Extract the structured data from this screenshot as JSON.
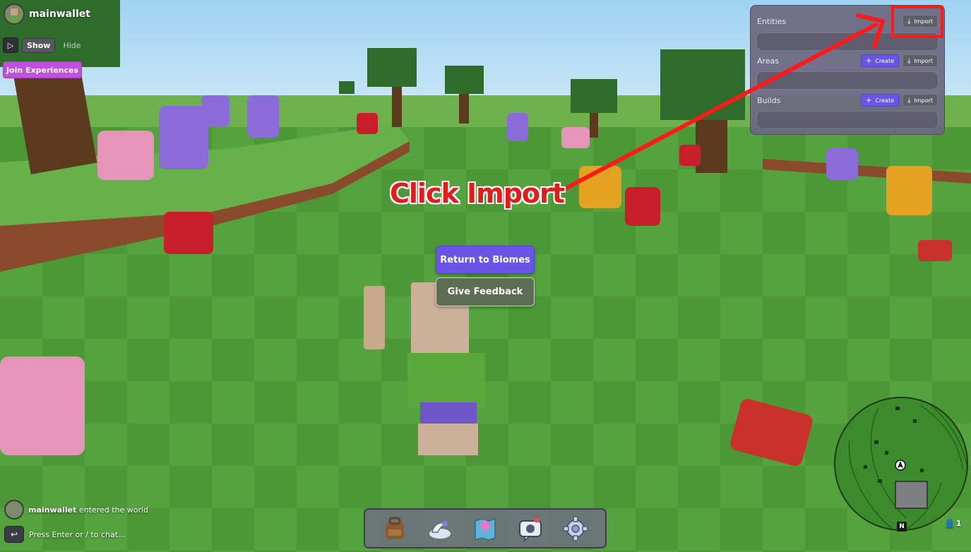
{
  "hud": {
    "username": "mainwallet",
    "show_label": "Show",
    "hide_label": "Hide",
    "join_label": "Join Experiences"
  },
  "center": {
    "return_label": "Return to Biomes",
    "feedback_label": "Give Feedback"
  },
  "panel": {
    "entities_label": "Entities",
    "areas_label": "Areas",
    "builds_label": "Builds",
    "import_label": "Import",
    "create_label": "Create"
  },
  "annotation": {
    "text": "Click Import",
    "color": "#e31b1b"
  },
  "hotbar": {
    "items": [
      "backpack-icon",
      "bird-emote-icon",
      "map-icon",
      "camera-icon",
      "settings-gear-icon"
    ]
  },
  "chat": {
    "message_user": "mainwallet",
    "message_text": " entered the world",
    "input_hint": "Press Enter or / to chat..."
  },
  "minimap": {
    "north_label": "N",
    "player_count": "1"
  },
  "colors": {
    "accent_purple": "#6b55e8",
    "join_pink": "#c24fe0",
    "grass": "#4f9a3a",
    "annotation_red": "#ff1a1a"
  }
}
